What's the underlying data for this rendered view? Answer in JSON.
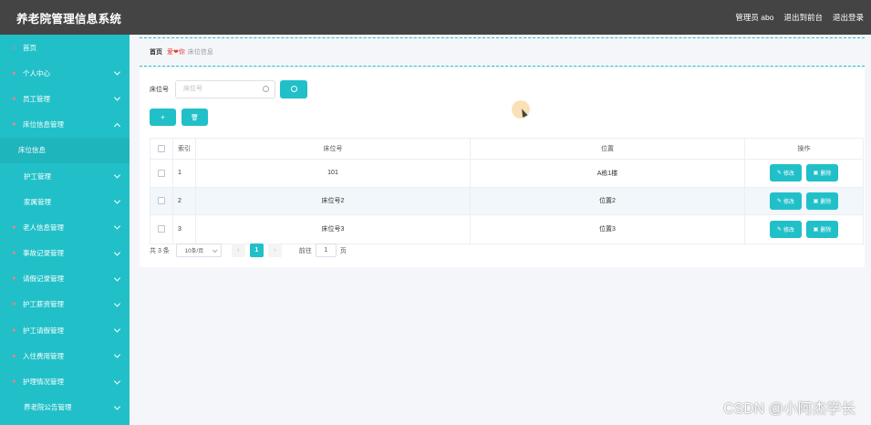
{
  "app": {
    "title": "养老院管理信息系统"
  },
  "header": {
    "user_label": "管理员 abo",
    "front_label": "退出到前台",
    "logout_label": "退出登录"
  },
  "sidebar": {
    "items": [
      {
        "label": "首页",
        "icon": "home-icon",
        "expandable": false
      },
      {
        "label": "个人中心",
        "icon": "user-icon",
        "expandable": true
      },
      {
        "label": "员工管理",
        "icon": "staff-icon",
        "expandable": true
      },
      {
        "label": "床位信息管理",
        "icon": "bed-icon",
        "expandable": true,
        "expanded": true
      },
      {
        "label": "床位信息",
        "sub": true,
        "active": true
      },
      {
        "label": "护工管理",
        "icon": "nurse-icon",
        "expandable": true
      },
      {
        "label": "家属管理",
        "icon": "family-icon",
        "expandable": true
      },
      {
        "label": "老人信息管理",
        "icon": "elder-icon",
        "expandable": true
      },
      {
        "label": "事故记录管理",
        "icon": "accident-icon",
        "expandable": true
      },
      {
        "label": "请假记录管理",
        "icon": "leave-icon",
        "expandable": true
      },
      {
        "label": "护工薪资管理",
        "icon": "salary-icon",
        "expandable": true
      },
      {
        "label": "护工请假管理",
        "icon": "leave-request-icon",
        "expandable": true
      },
      {
        "label": "入住费用管理",
        "icon": "fee-icon",
        "expandable": true
      },
      {
        "label": "护理情况管理",
        "icon": "care-icon",
        "expandable": true
      },
      {
        "label": "养老院公告管理",
        "icon": "notice-icon",
        "expandable": true
      }
    ]
  },
  "breadcrumb": {
    "home": "首页",
    "love": "爱",
    "heart": "❤",
    "you": "你",
    "current": "床位信息"
  },
  "search": {
    "label": "床位号",
    "placeholder": "床位号"
  },
  "toolbar": {
    "add_label": "+",
    "delete_label": "🗑"
  },
  "table": {
    "columns": [
      "索引",
      "床位号",
      "位置",
      "操作"
    ],
    "rows": [
      {
        "index": "1",
        "bed": "101",
        "position": "A栋1楼"
      },
      {
        "index": "2",
        "bed": "床位号2",
        "position": "位置2"
      },
      {
        "index": "3",
        "bed": "床位号3",
        "position": "位置3"
      }
    ],
    "edit_label": "修改",
    "delete_label": "删除"
  },
  "pagination": {
    "total": "共 3 条",
    "page_size": "10条/页",
    "prev": "‹",
    "current_page": "1",
    "next": "›",
    "goto_label": "前往",
    "goto_value": "1",
    "page_unit": "页"
  },
  "watermark": "CSDN @小阿杰学长",
  "colors": {
    "accent": "#21c0c8",
    "topbar": "#444444",
    "icon_red": "#ff7d7d"
  }
}
